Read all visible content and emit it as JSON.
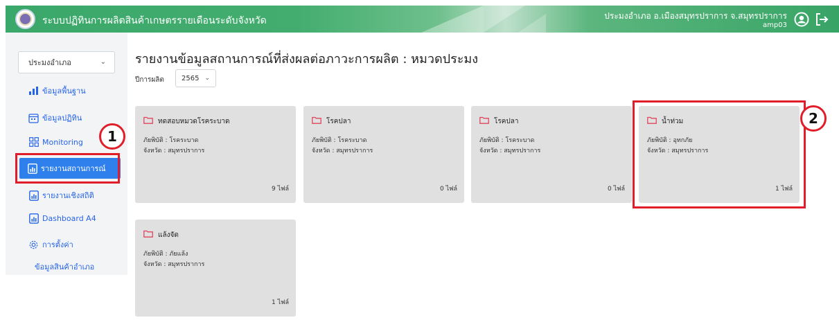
{
  "header": {
    "app_title": "ระบบปฏิทินการผลิตสินค้าเกษตรรายเดือนระดับจังหวัด",
    "user_line": "ประมงอำเภอ อ.เมืองสมุทรปราการ จ.สมุทรปราการ",
    "user_code": "amp03",
    "icons": [
      "account-icon",
      "logout-icon"
    ]
  },
  "sidebar": {
    "select_value": "ประมงอำเภอ",
    "items": [
      {
        "label": "ข้อมูลพื้นฐาน",
        "icon": "bar-chart-icon"
      },
      {
        "label": "ข้อมูลปฏิทิน",
        "icon": "calendar-icon"
      },
      {
        "label": "Monitoring",
        "icon": "grid-icon"
      },
      {
        "label": "รายงานสถานการณ์",
        "icon": "report-icon"
      },
      {
        "label": "รายงานเชิงสถิติ",
        "icon": "report-icon"
      },
      {
        "label": "Dashboard A4",
        "icon": "report-icon"
      },
      {
        "label": "การตั้งค่า",
        "icon": "gear-icon"
      },
      {
        "label": "ข้อมูลสินค้าอำเภอ"
      }
    ]
  },
  "main": {
    "title": "รายงานข้อมูลสถานการณ์ที่ส่งผลต่อภาวะการผลิต : หมวดประมง",
    "year_label": "ปีการผลิต",
    "year_value": "2565",
    "cards": [
      {
        "name": "ทดสอบหมวดโรคระบาด",
        "hazard": "ภัยพิบัติ : โรคระบาด",
        "province": "จังหวัด : สมุทรปราการ",
        "files": "9 ไฟล์"
      },
      {
        "name": "โรคปลา",
        "hazard": "ภัยพิบัติ : โรคระบาด",
        "province": "จังหวัด : สมุทรปราการ",
        "files": "0 ไฟล์"
      },
      {
        "name": "โรคปลา",
        "hazard": "ภัยพิบัติ : โรคระบาด",
        "province": "จังหวัด : สมุทรปราการ",
        "files": "0 ไฟล์"
      },
      {
        "name": "น้ำท่วม",
        "hazard": "ภัยพิบัติ : อุทกภัย",
        "province": "จังหวัด : สมุทรปราการ",
        "files": "1 ไฟล์"
      },
      {
        "name": "แล้งจัด",
        "hazard": "ภัยพิบัติ : ภัยแล้ง",
        "province": "จังหวัด : สมุทรปราการ",
        "files": "1 ไฟล์"
      }
    ]
  },
  "annotations": {
    "badge1": "1",
    "badge2": "2",
    "color": "#e11d2a"
  },
  "colors": {
    "header": "#3aa86a",
    "active": "#2f80ed",
    "link": "#2563eb",
    "card": "#e0e0e0"
  }
}
